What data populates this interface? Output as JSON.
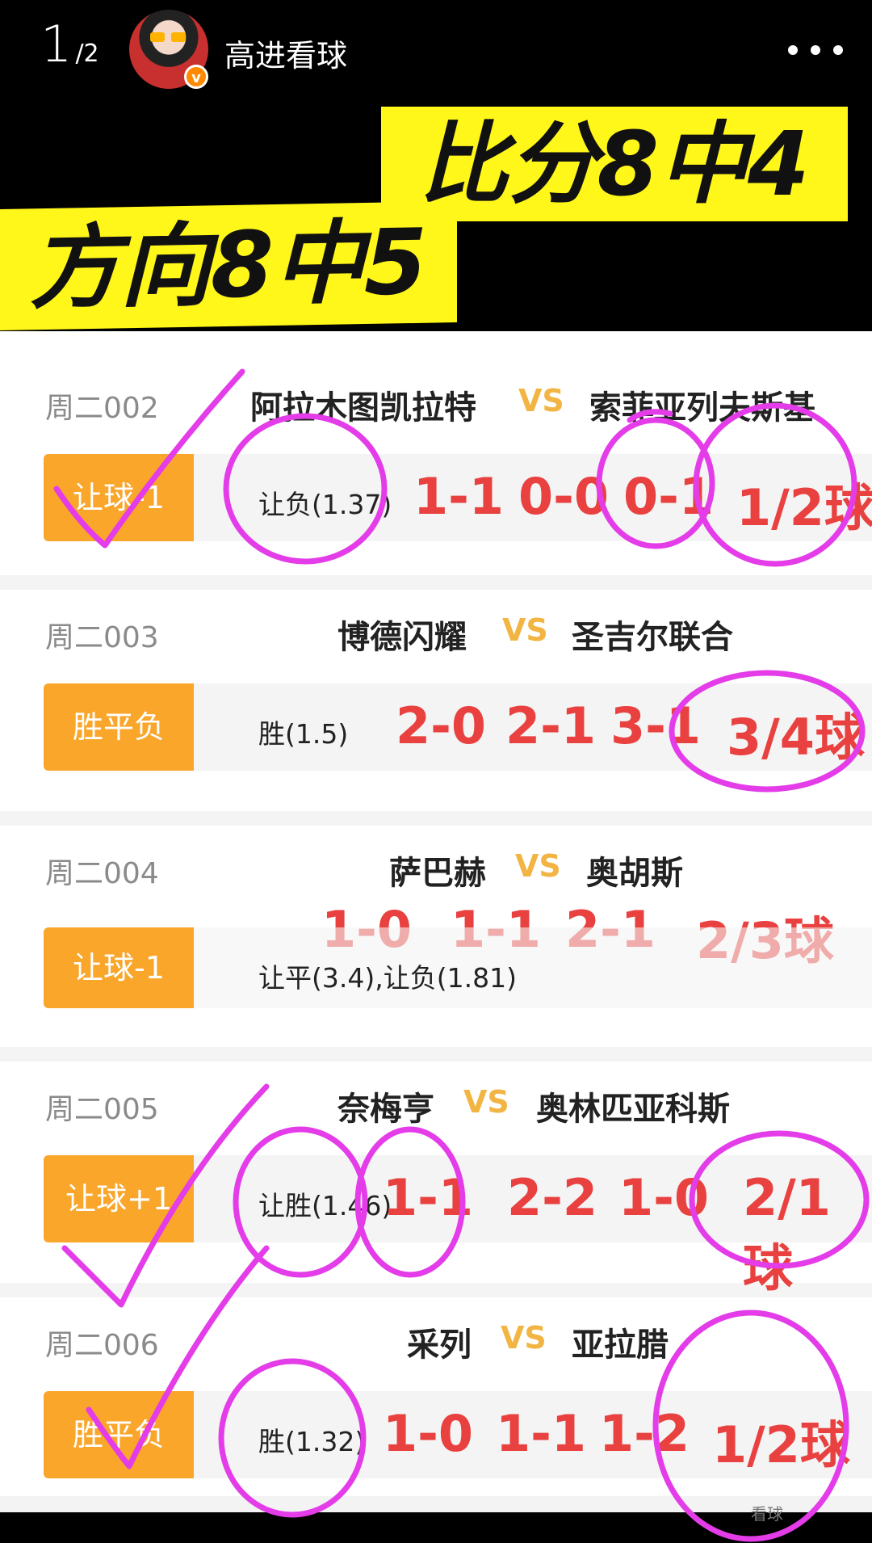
{
  "header": {
    "page_current": "1",
    "page_total": "/2",
    "author": "高进看球",
    "verified_badge": "v",
    "icons": [
      "avatar",
      "verified-badge-icon",
      "more-icon"
    ]
  },
  "banners": {
    "score_text": "比分8中4",
    "direction_text": "方向8中5",
    "color": "#fff61a"
  },
  "matches": [
    {
      "code": "周二002",
      "home": "阿拉木图凯拉特",
      "vs": "VS",
      "away": "索菲亚列夫斯基",
      "bet_type": "让球-1",
      "pick": "让负(1.37)",
      "scores": [
        "1-1",
        "0-0",
        "0-1",
        "1/2球"
      ]
    },
    {
      "code": "周二003",
      "home": "博德闪耀",
      "vs": "VS",
      "away": "圣吉尔联合",
      "bet_type": "胜平负",
      "pick": "胜(1.5)",
      "scores": [
        "2-0",
        "2-1",
        "3-1",
        "3/4球"
      ]
    },
    {
      "code": "周二004",
      "home": "萨巴赫",
      "vs": "VS",
      "away": "奥胡斯",
      "bet_type": "让球-1",
      "pick": "让平(3.4),让负(1.81)",
      "scores": [
        "1-0",
        "1-1",
        "2-1",
        "2/3球"
      ]
    },
    {
      "code": "周二005",
      "home": "奈梅亨",
      "vs": "VS",
      "away": "奥林匹亚科斯",
      "bet_type": "让球+1",
      "pick": "让胜(1.46)",
      "scores": [
        "1-1",
        "2-2",
        "1-0",
        "2/1球"
      ]
    },
    {
      "code": "周二006",
      "home": "采列",
      "vs": "VS",
      "away": "亚拉腊",
      "bet_type": "胜平负",
      "pick": "胜(1.32)",
      "scores": [
        "1-0",
        "1-1",
        "1-2",
        "1/2球"
      ]
    }
  ],
  "colors": {
    "score_red": "#e8413f",
    "tag_orange": "#f9a62b",
    "vs_gold": "#f2b544",
    "ink_magenta": "#e33ce8"
  },
  "watermark": "看球"
}
